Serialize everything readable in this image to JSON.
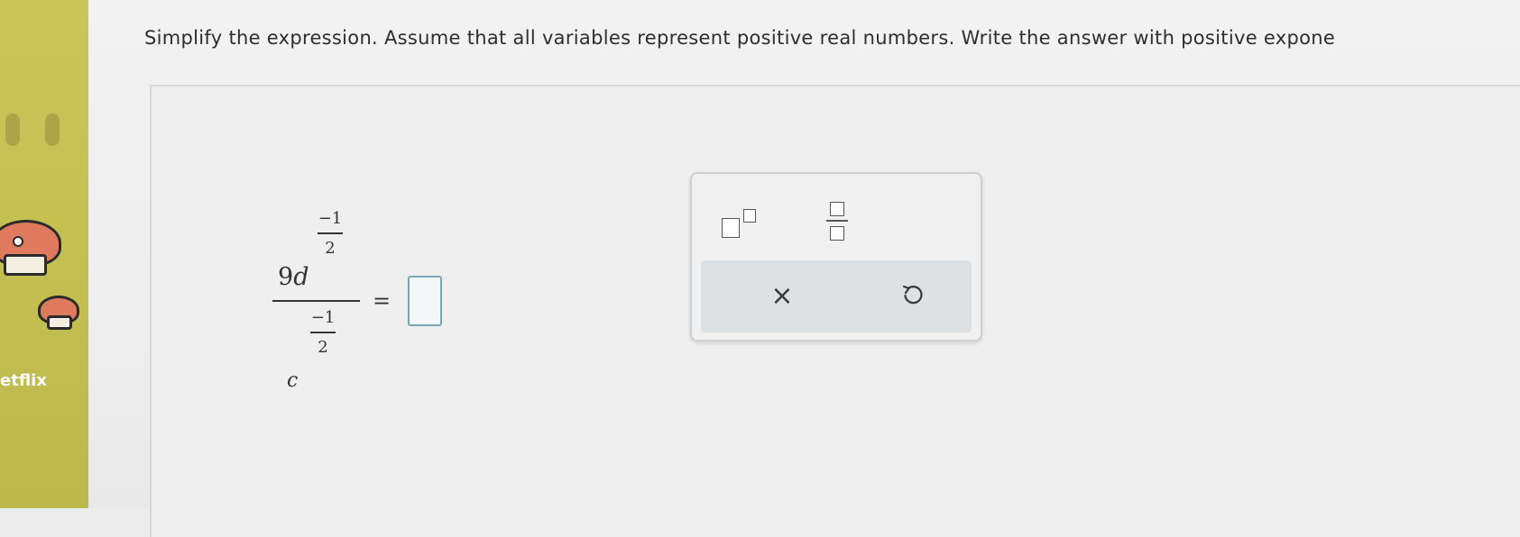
{
  "desktop": {
    "netflix_label": "etflix"
  },
  "question": {
    "instruction": "Simplify the expression. Assume that all variables represent positive real numbers. Write the answer with positive expone"
  },
  "expression": {
    "numerator_coefficient": "9",
    "numerator_variable": "d",
    "numerator_exponent_top": "−1",
    "numerator_exponent_bottom": "2",
    "denominator_variable": "c",
    "denominator_exponent_top": "−1",
    "denominator_exponent_bottom": "2",
    "equals_sign": "="
  },
  "answer": {
    "value": ""
  },
  "palette": {
    "clear_symbol": "×",
    "exponent_tool": "exponent-template",
    "fraction_tool": "fraction-template",
    "undo_icon": "undo-icon"
  },
  "colors": {
    "answer_box_border": "#79a6b4",
    "strip": "#c4c052"
  }
}
